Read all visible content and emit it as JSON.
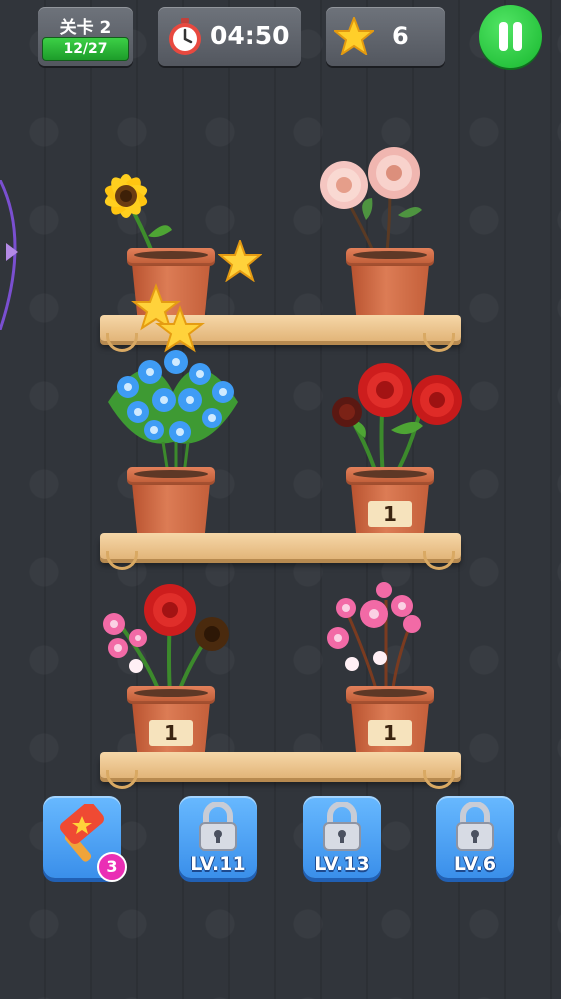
{
  "hud": {
    "level_label": "关卡 2",
    "progress_text": "12/27",
    "progress_fraction": 0.444,
    "timer": "04:50",
    "stars": "6"
  },
  "pots": [
    {
      "flower": "sunflower-yellow",
      "count_label": ""
    },
    {
      "flower": "peony-pink",
      "count_label": ""
    },
    {
      "flower": "blue-bouquet",
      "count_label": ""
    },
    {
      "flower": "red-rose",
      "count_label": "1"
    },
    {
      "flower": "rose-mix",
      "count_label": "1"
    },
    {
      "flower": "pink-blossom",
      "count_label": "1"
    }
  ],
  "boosters": {
    "hammer_count": "3",
    "locked": [
      {
        "label": "LV.11"
      },
      {
        "label": "LV.13"
      },
      {
        "label": "LV.6"
      }
    ]
  },
  "colors": {
    "background": "#2e3238",
    "accent_green": "#17b72e",
    "button_blue": "#3a8fea",
    "badge_pink": "#ea2fb5"
  }
}
